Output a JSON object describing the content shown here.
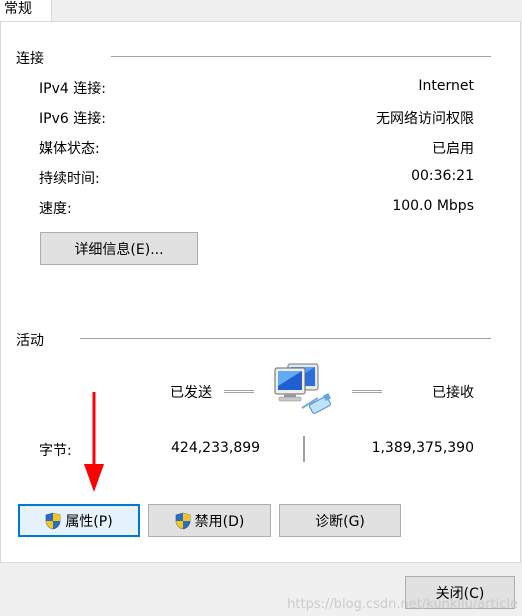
{
  "tab": {
    "label": "常规"
  },
  "connection": {
    "title": "连接",
    "rows": [
      {
        "label": "IPv4 连接:",
        "value": "Internet"
      },
      {
        "label": "IPv6 连接:",
        "value": "无网络访问权限"
      },
      {
        "label": "媒体状态:",
        "value": "已启用"
      },
      {
        "label": "持续时间:",
        "value": "00:36:21"
      },
      {
        "label": "速度:",
        "value": "100.0 Mbps"
      }
    ],
    "details_button": "详细信息(E)..."
  },
  "activity": {
    "title": "活动",
    "sent_label": "已发送",
    "received_label": "已接收",
    "bytes_label": "字节:",
    "bytes_sent": "424,233,899",
    "bytes_received": "1,389,375,390"
  },
  "buttons": {
    "properties": "属性(P)",
    "disable": "禁用(D)",
    "diagnose": "诊断(G)",
    "close": "关闭(C)"
  },
  "watermark": "https://blog.csdn.net/kunkliu/article",
  "colors": {
    "focus_border": "#0078d7",
    "annotation_arrow": "#ff0000",
    "shield_blue": "#2b6cc4",
    "shield_yellow": "#f5c518"
  },
  "icons": [
    "network-computers-icon",
    "uac-shield-icon",
    "red-arrow-annotation"
  ]
}
